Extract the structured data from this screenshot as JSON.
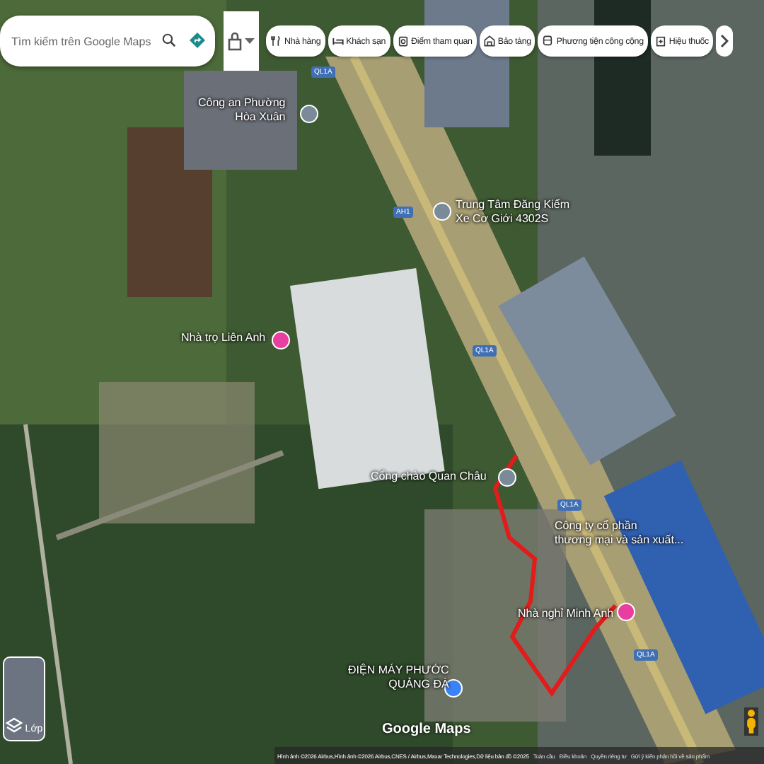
{
  "search": {
    "placeholder": "Tìm kiếm trên Google Maps"
  },
  "chips": [
    {
      "label": "Nhà hàng",
      "kind": "restaurant"
    },
    {
      "label": "Khách sạn",
      "kind": "hotel"
    },
    {
      "label": "Điểm tham quan",
      "kind": "attraction"
    },
    {
      "label": "Bảo tàng",
      "kind": "museum"
    },
    {
      "label": "Phương tiện công cộng",
      "kind": "transit"
    },
    {
      "label": "Hiệu thuốc",
      "kind": "pharmacy"
    }
  ],
  "places": [
    {
      "name": "Công an Phường\nHòa Xuân",
      "color": "#7b8a99"
    },
    {
      "name": "Trung Tâm Đăng Kiểm\nXe Cơ Giới 4302S",
      "color": "#7b8a99"
    },
    {
      "name": "Nhà trọ Liên Anh",
      "color": "#e83e9f"
    },
    {
      "name": "Cổng chào Quan Châu",
      "color": "#7b8a99"
    },
    {
      "name": "Công ty cổ phần\nthương mại và sản xuất..."
    },
    {
      "name": "Nhà nghỉ Minh Anh",
      "color": "#e83e9f"
    },
    {
      "name": "ĐIỆN MÁY PHƯỚC\nQUẢNG ĐÀ",
      "color": "#3b82f6"
    }
  ],
  "road_shields": [
    "QL1A",
    "AH1",
    "QL1A",
    "QL1A",
    "QL1A"
  ],
  "layers_button": {
    "label": "Lớp"
  },
  "logo": "Google Maps",
  "footer": [
    "Hình ảnh ©2026 Airbus,Hình ảnh ©2026 Airbus,CNES / Airbus,Maxar Technologies,Dữ liệu bản đồ ©2025",
    "Toàn cầu",
    "Điều khoản",
    "Quyền riêng tư",
    "Gửi ý kiến phản hồi về sản phẩm"
  ]
}
